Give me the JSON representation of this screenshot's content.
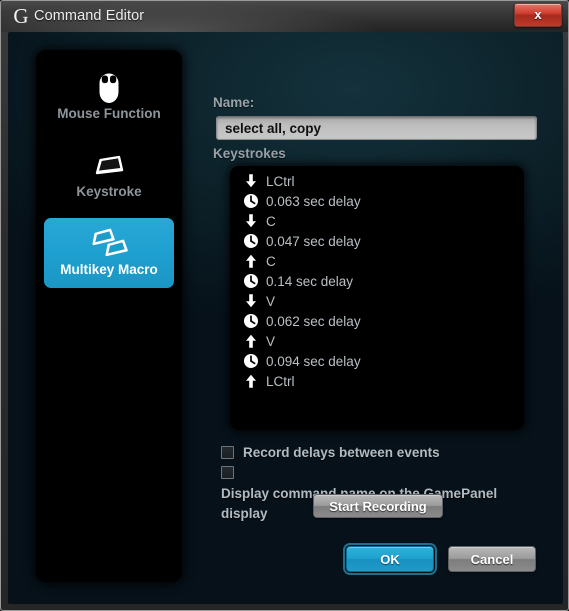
{
  "window": {
    "title": "Command Editor",
    "logo_glyph": "G",
    "close_label": "x",
    "accent_color": "#1fa2cf",
    "close_color": "#cf3e2f",
    "background_color": "#0c2028"
  },
  "sidebar": {
    "items": [
      {
        "label": "Mouse Function",
        "icon": "mouse-icon",
        "selected": false
      },
      {
        "label": "Keystroke",
        "icon": "keycap-icon",
        "selected": false
      },
      {
        "label": "Multikey Macro",
        "icon": "multi-keycap-icon",
        "selected": true
      }
    ]
  },
  "form": {
    "name_label": "Name:",
    "name_value": "select all, copy",
    "name_placeholder": "",
    "keystrokes_label": "Keystrokes"
  },
  "keystrokes": {
    "rows": [
      {
        "icon": "key-down-arrow-icon",
        "text": "LCtrl"
      },
      {
        "icon": "clock-icon",
        "text": "0.063 sec delay"
      },
      {
        "icon": "key-down-arrow-icon",
        "text": "C"
      },
      {
        "icon": "clock-icon",
        "text": "0.047 sec delay"
      },
      {
        "icon": "key-up-arrow-icon",
        "text": "C"
      },
      {
        "icon": "clock-icon",
        "text": "0.14 sec delay"
      },
      {
        "icon": "key-down-arrow-icon",
        "text": "V"
      },
      {
        "icon": "clock-icon",
        "text": "0.062 sec delay"
      },
      {
        "icon": "key-up-arrow-icon",
        "text": "V"
      },
      {
        "icon": "clock-icon",
        "text": "0.094 sec delay"
      },
      {
        "icon": "key-up-arrow-icon",
        "text": "LCtrl"
      }
    ]
  },
  "options": {
    "checkboxes": [
      {
        "label": "Record delays between events",
        "checked": false
      },
      {
        "label": "Display command name on the GamePanel display",
        "checked": false
      }
    ]
  },
  "buttons": {
    "start_recording": "Start Recording",
    "ok": "OK",
    "cancel": "Cancel"
  }
}
